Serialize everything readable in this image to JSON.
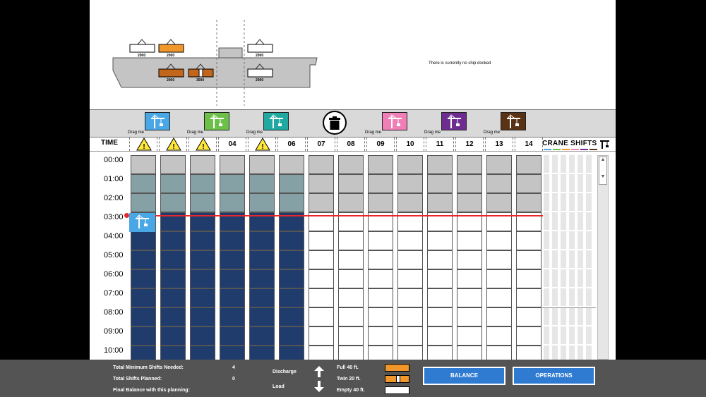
{
  "ship": {
    "no_ship_text": "There is currently no ship docked",
    "container_labels": [
      "2000",
      "2000",
      "2000",
      "2000",
      "3000",
      "2000",
      "2000"
    ]
  },
  "toolbar": {
    "cranes": [
      {
        "color": "#4aa7e6",
        "drag_label": "Drag me"
      },
      {
        "color": "#6cc04a",
        "drag_label": "Drag me"
      },
      {
        "color": "#1fa9a0",
        "drag_label": "Drag me"
      },
      {
        "color": "#f07fb7",
        "drag_label": "Drag me"
      },
      {
        "color": "#6e2c91",
        "drag_label": "Drag me"
      },
      {
        "color": "#5a3214",
        "drag_label": "Drag me"
      }
    ],
    "trash_icon": "trash-icon"
  },
  "grid": {
    "time_header": "TIME",
    "columns": [
      "",
      "",
      "",
      "04",
      "",
      "06",
      "07",
      "08",
      "09",
      "10",
      "11",
      "12",
      "13",
      "14"
    ],
    "warning_columns": [
      0,
      1,
      2,
      4
    ],
    "times": [
      "00:00",
      "01:00",
      "02:00",
      "03:00",
      "04:00",
      "05:00",
      "06:00",
      "07:00",
      "08:00",
      "09:00",
      "10:00"
    ],
    "crane_shifts_header": "CRANE SHIFTS",
    "crane_shift_colors": [
      "#4aa7e6",
      "#6cc04a",
      "#f0962b",
      "#f07fb7",
      "#6e2c91",
      "#5a3214"
    ]
  },
  "footer": {
    "min_shifts_label": "Total Minimum Shifts Needed:",
    "min_shifts_value": "4",
    "planned_label": "Total Shifts Planned:",
    "planned_value": "0",
    "final_balance_label": "Final Balance with this planning:",
    "discharge_label": "Discharge",
    "load_label": "Load",
    "full_label": "Full 40 ft.",
    "twin_label": "Twin 20 ft.",
    "empty_label": "Empty 40 ft.",
    "balance_button": "BALANCE",
    "operations_button": "OPERATIONS"
  },
  "colors": {
    "orange": "#f0962b",
    "brown": "#c2661c",
    "navy": "#1f3c6c",
    "teal_gray": "#86a1a6",
    "gray": "#c4c4c4",
    "accent_blue": "#2f7bd2"
  }
}
